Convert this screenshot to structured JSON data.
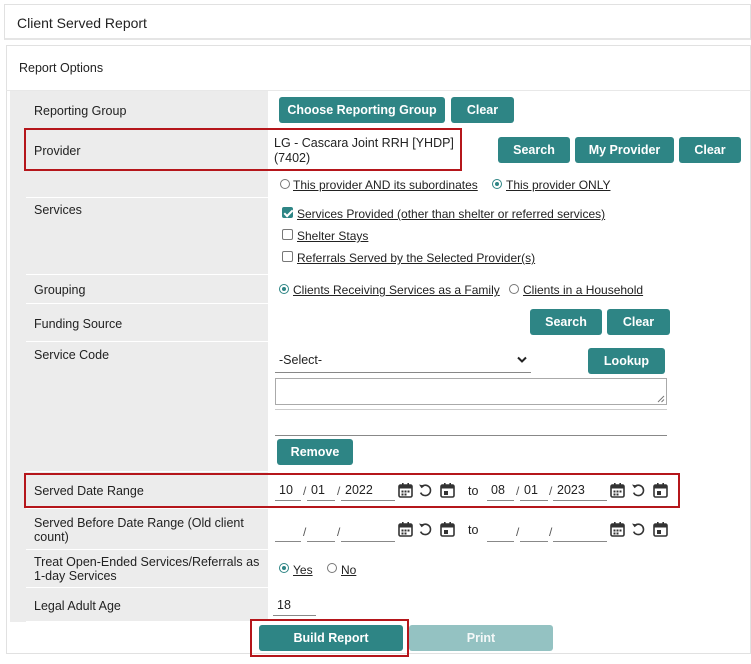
{
  "header": {
    "title": "Client Served Report"
  },
  "options": {
    "title": "Report Options"
  },
  "reporting_group": {
    "label": "Reporting Group",
    "choose_btn": "Choose Reporting Group",
    "clear_btn": "Clear"
  },
  "provider": {
    "label": "Provider",
    "value_line1": "LG - Cascara Joint RRH [YHDP]",
    "value_line2": "(7402)",
    "search_btn": "Search",
    "my_provider_btn": "My Provider",
    "clear_btn": "Clear",
    "option_subordinates": "This provider AND its subordinates",
    "option_only": "This provider ONLY"
  },
  "services": {
    "label": "Services",
    "options": [
      {
        "label": "Services Provided (other than shelter or referred services)",
        "checked": true
      },
      {
        "label": "Shelter Stays",
        "checked": false
      },
      {
        "label": "Referrals Served by the Selected Provider(s)",
        "checked": false
      }
    ]
  },
  "grouping": {
    "label": "Grouping",
    "option_family": "Clients Receiving Services as a Family",
    "option_household": "Clients in a Household",
    "selected": "family"
  },
  "funding": {
    "label": "Funding Source",
    "search_btn": "Search",
    "clear_btn": "Clear"
  },
  "service_code": {
    "label": "Service Code",
    "select_value": "-Select-",
    "lookup_btn": "Lookup",
    "remove_btn": "Remove"
  },
  "served_date_range": {
    "label": "Served Date Range",
    "from": {
      "month": "10",
      "day": "01",
      "year": "2022"
    },
    "to_label": "to",
    "to": {
      "month": "08",
      "day": "01",
      "year": "2023"
    }
  },
  "served_before": {
    "label_line1": "Served Before Date Range (Old client",
    "label_line2": "count)",
    "to_label": "to"
  },
  "treat_open_ended": {
    "label_line1": "Treat Open-Ended Services/Referrals as",
    "label_line2": "1-day Services",
    "yes": "Yes",
    "no": "No",
    "selected": "yes"
  },
  "legal_adult_age": {
    "label": "Legal Adult Age",
    "value": "18"
  },
  "actions": {
    "build_btn": "Build Report",
    "print_btn": "Print"
  },
  "colors": {
    "accent": "#2e8585",
    "accent_disabled": "#94c2c2",
    "highlight": "#b5161b",
    "label_bg": "#ececec"
  }
}
